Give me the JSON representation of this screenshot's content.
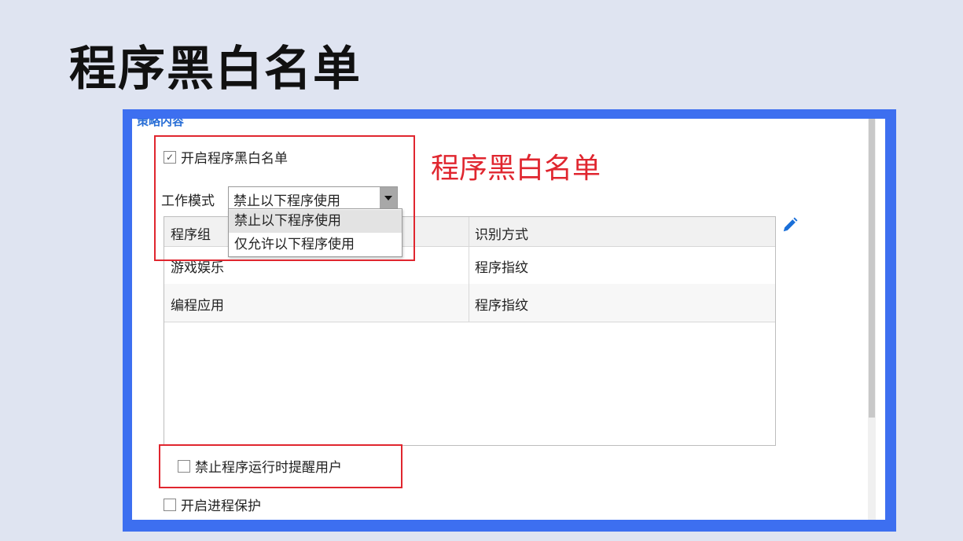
{
  "slide": {
    "title": "程序黑白名单"
  },
  "callout": {
    "text": "程序黑白名单"
  },
  "panel": {
    "section_header": "策略内容",
    "enable_blacklist_label": "开启程序黑白名单",
    "enable_blacklist_checked": true,
    "work_mode_label": "工作模式",
    "work_mode_value": "禁止以下程序使用",
    "work_mode_options": [
      "禁止以下程序使用",
      "仅允许以下程序使用"
    ],
    "table": {
      "columns": [
        "程序组",
        "识别方式"
      ],
      "rows": [
        [
          "游戏娱乐",
          "程序指纹"
        ],
        [
          "编程应用",
          "程序指纹"
        ]
      ]
    },
    "remind_user_label": "禁止程序运行时提醒用户",
    "remind_user_checked": false,
    "process_protect_label": "开启进程保护",
    "process_protect_checked": false
  },
  "colors": {
    "frame_border": "#3d6ff0",
    "highlight_red": "#e0262f",
    "header_blue": "#2a6fd6",
    "edit_icon": "#1a6fd8"
  },
  "icons": {
    "checked_box": "☑",
    "edit": "pencil-icon"
  }
}
